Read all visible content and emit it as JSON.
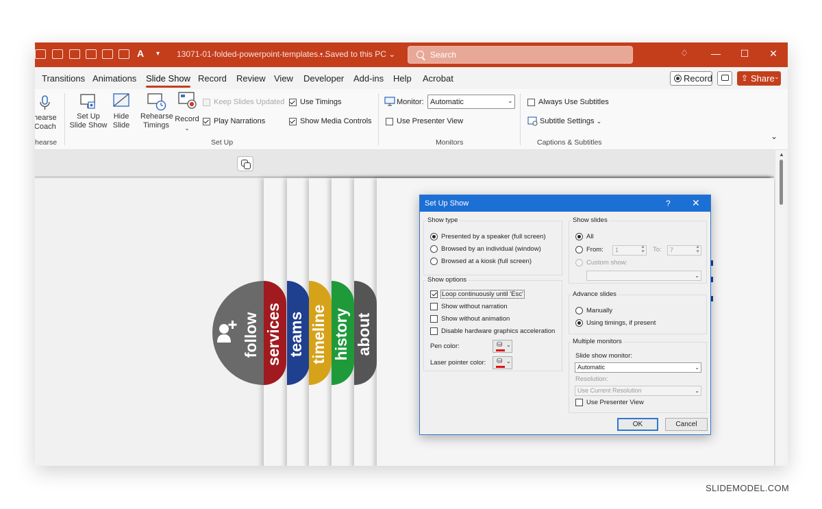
{
  "titlebar": {
    "filename": "13071-01-folded-powerpoint-templates....",
    "saved_status": "• Saved to this PC",
    "search_placeholder": "Search",
    "colors": {
      "accent": "#c43e1c"
    }
  },
  "tabs": {
    "items": [
      "Transitions",
      "Animations",
      "Slide Show",
      "Record",
      "Review",
      "View",
      "Developer",
      "Add-ins",
      "Help",
      "Acrobat"
    ],
    "active": "Slide Show",
    "record_button": "Record",
    "share_button": "Share"
  },
  "ribbon": {
    "rehearse_coach_line1": "hearse",
    "rehearse_coach_line2": "Coach",
    "rehearse_group_label": "hearse",
    "set_up_slide_show_line1": "Set Up",
    "set_up_slide_show_line2": "Slide Show",
    "hide_slide_line1": "Hide",
    "hide_slide_line2": "Slide",
    "rehearse_timings_line1": "Rehearse",
    "rehearse_timings_line2": "Timings",
    "record_label": "Record",
    "keep_slides_updated": "Keep Slides Updated",
    "play_narrations": "Play Narrations",
    "use_timings": "Use Timings",
    "show_media_controls": "Show Media Controls",
    "setup_group_label": "Set Up",
    "monitor_label": "Monitor:",
    "monitor_value": "Automatic",
    "use_presenter_view": "Use Presenter View",
    "monitors_group_label": "Monitors",
    "always_use_subtitles": "Always Use Subtitles",
    "subtitle_settings": "Subtitle Settings",
    "captions_group_label": "Captions & Subtitles"
  },
  "slide": {
    "tabs": [
      {
        "label": "follow",
        "color": "#6a6a6a"
      },
      {
        "label": "services",
        "color": "#a11a1f"
      },
      {
        "label": "teams",
        "color": "#1f3f8f"
      },
      {
        "label": "timeline",
        "color": "#d6a21a"
      },
      {
        "label": "history",
        "color": "#1e9a3a"
      },
      {
        "label": "about",
        "color": "#555555"
      }
    ]
  },
  "dialog": {
    "title": "Set Up Show",
    "help": "?",
    "show_type": {
      "legend": "Show type",
      "options": [
        "Presented by a speaker (full screen)",
        "Browsed by an individual (window)",
        "Browsed at a kiosk (full screen)"
      ],
      "selected": "Presented by a speaker (full screen)"
    },
    "show_options": {
      "legend": "Show options",
      "loop": "Loop continuously until 'Esc'",
      "without_narration": "Show without narration",
      "without_animation": "Show without animation",
      "disable_hw": "Disable hardware graphics acceleration",
      "pen_color": "Pen color:",
      "laser_color": "Laser pointer color:"
    },
    "show_slides": {
      "legend": "Show slides",
      "all": "All",
      "from": "From:",
      "from_value": "1",
      "to": "To:",
      "to_value": "7",
      "custom_show": "Custom show:"
    },
    "advance_slides": {
      "legend": "Advance slides",
      "manually": "Manually",
      "using_timings": "Using timings, if present"
    },
    "multiple_monitors": {
      "legend": "Multiple monitors",
      "slide_show_monitor": "Slide show monitor:",
      "monitor_value": "Automatic",
      "resolution": "Resolution:",
      "resolution_value": "Use Current Resolution",
      "presenter_view": "Use Presenter View"
    },
    "ok": "OK",
    "cancel": "Cancel"
  },
  "watermark": "SLIDEMODEL.COM"
}
